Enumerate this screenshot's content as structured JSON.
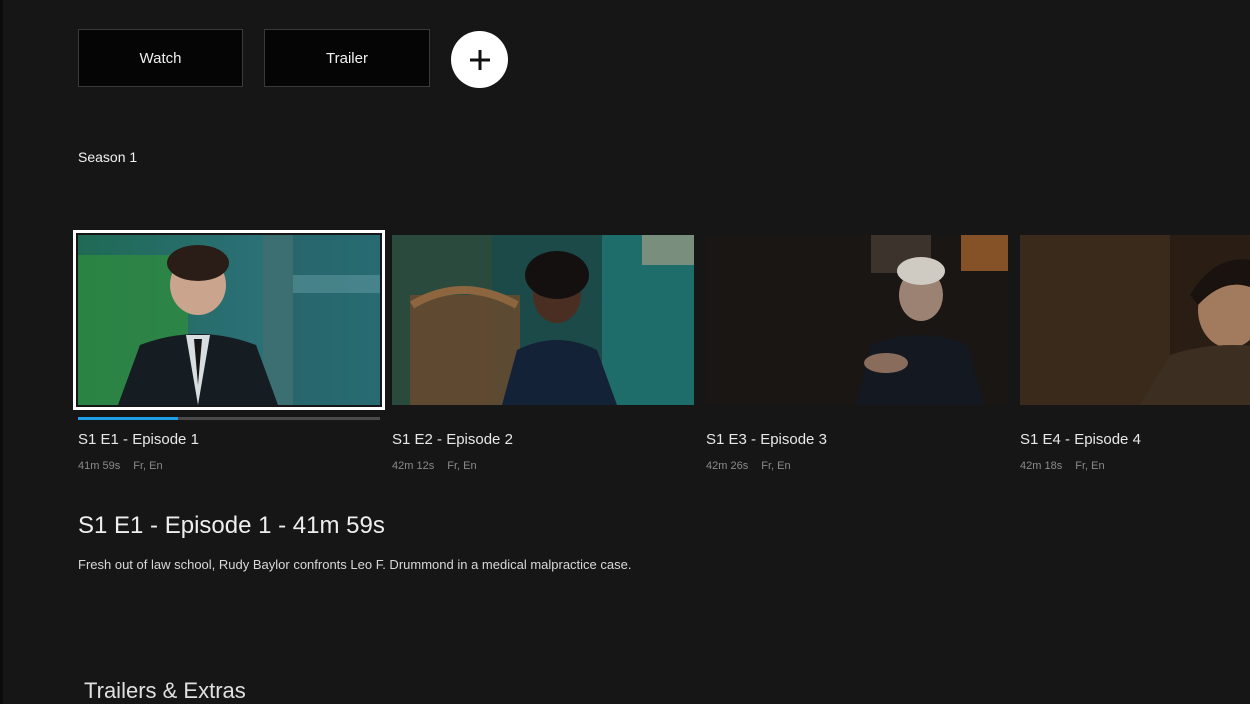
{
  "actions": {
    "watch_label": "Watch",
    "trailer_label": "Trailer",
    "add_icon": "plus-icon"
  },
  "season": {
    "label": "Season 1"
  },
  "episodes": [
    {
      "title": "S1 E1 - Episode 1",
      "duration": "41m 59s",
      "languages": "Fr, En",
      "progress": 0.33,
      "selected": true
    },
    {
      "title": "S1 E2 - Episode 2",
      "duration": "42m 12s",
      "languages": "Fr, En"
    },
    {
      "title": "S1 E3 - Episode 3",
      "duration": "42m 26s",
      "languages": "Fr, En"
    },
    {
      "title": "S1 E4 - Episode 4",
      "duration": "42m 18s",
      "languages": "Fr, En"
    }
  ],
  "detail": {
    "heading": "S1 E1 - Episode 1 - 41m 59s",
    "description": "Fresh out of law school, Rudy Baylor confronts Leo F. Drummond in a medical malpractice case."
  },
  "extras": {
    "title": "Trailers & Extras"
  },
  "colors": {
    "accent": "#1ea0e6",
    "background": "#161616"
  }
}
